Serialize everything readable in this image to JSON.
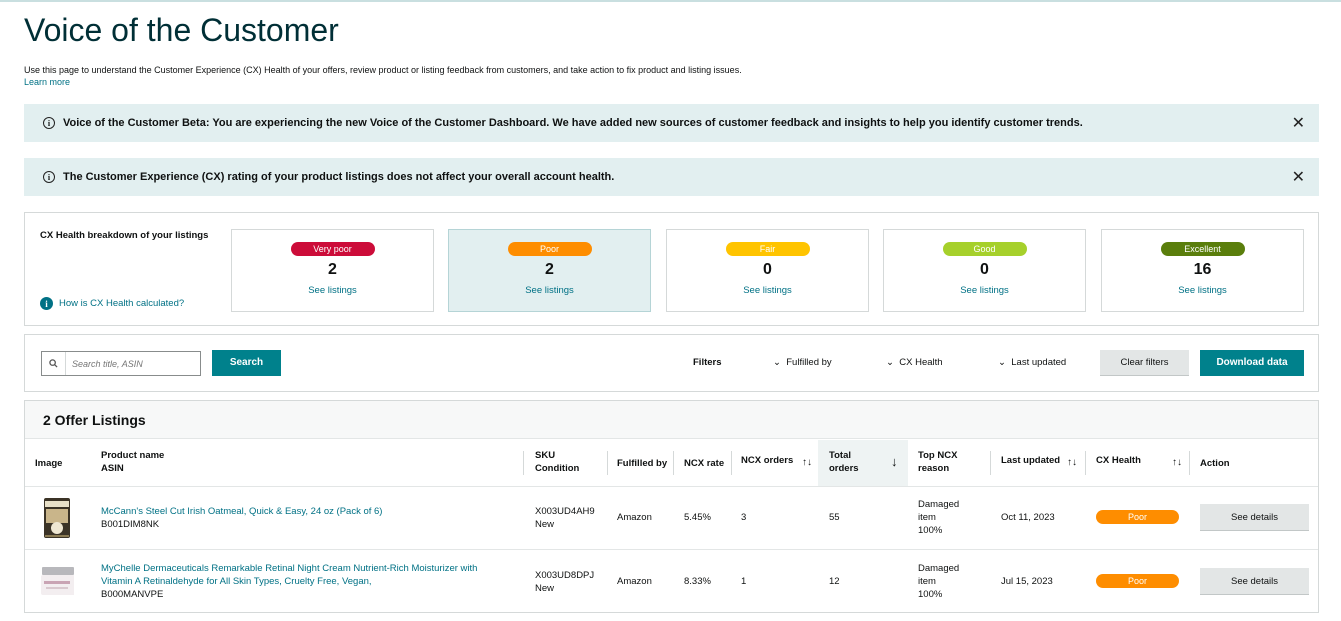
{
  "page": {
    "title": "Voice of the Customer",
    "description": "Use this page to understand the Customer Experience (CX) Health of your offers, review product or listing feedback from customers, and take action to fix product and listing issues.",
    "learn_more": "Learn more"
  },
  "banners": [
    {
      "icon": "info-icon",
      "text": "Voice of the Customer Beta: You are experiencing the new Voice of the Customer Dashboard. We have added new sources of customer feedback and insights to help you identify customer trends."
    },
    {
      "icon": "info-icon",
      "text": "The Customer Experience (CX) rating of your product listings does not affect your overall account health."
    }
  ],
  "cx_health": {
    "heading": "CX Health breakdown of your listings",
    "how_link": "How is CX Health calculated?",
    "cards": [
      {
        "label": "Very poor",
        "count": "2",
        "link": "See listings",
        "color": "#cc0c39"
      },
      {
        "label": "Poor",
        "count": "2",
        "link": "See listings",
        "color": "#fe8d00"
      },
      {
        "label": "Fair",
        "count": "0",
        "link": "See listings",
        "color": "#ffc400"
      },
      {
        "label": "Good",
        "count": "0",
        "link": "See listings",
        "color": "#a6d02b"
      },
      {
        "label": "Excellent",
        "count": "16",
        "link": "See listings",
        "color": "#5a7e0c"
      }
    ]
  },
  "filters": {
    "search_placeholder": "Search title, ASIN",
    "search_button": "Search",
    "filters_label": "Filters",
    "fulfilled_by": "Fulfilled by",
    "cx_health": "CX Health",
    "last_updated": "Last updated",
    "clear": "Clear filters",
    "download": "Download data"
  },
  "table": {
    "title": "2 Offer Listings",
    "headers": {
      "image": "Image",
      "product_name": "Product name",
      "asin": "ASIN",
      "sku": "SKU",
      "condition": "Condition",
      "fulfilled_by": "Fulfilled by",
      "ncx_rate": "NCX rate",
      "ncx_orders": "NCX orders",
      "total": "Total",
      "orders": "orders",
      "top_ncx": "Top NCX",
      "reason": "reason",
      "last_updated": "Last updated",
      "cx_health": "CX Health",
      "action": "Action"
    },
    "rows": [
      {
        "product": "McCann's Steel Cut Irish Oatmeal, Quick & Easy, 24 oz (Pack of 6)",
        "asin": "B001DIM8NK",
        "sku": "X003UD4AH9",
        "condition": "New",
        "fulfilled_by": "Amazon",
        "ncx_rate": "5.45%",
        "ncx_orders": "3",
        "total_orders": "55",
        "reason_1": "Damaged",
        "reason_2": "item",
        "reason_3": "100%",
        "last_updated": "Oct 11, 2023",
        "cx_health": "Poor",
        "action": "See details"
      },
      {
        "product_line1": "MyChelle Dermaceuticals Remarkable Retinal Night Cream Nutrient-Rich Moisturizer with",
        "product_line2": "Vitamin A Retinaldehyde for All Skin Types, Cruelty Free, Vegan,",
        "asin": "B000MANVPE",
        "sku": "X003UD8DPJ",
        "condition": "New",
        "fulfilled_by": "Amazon",
        "ncx_rate": "8.33%",
        "ncx_orders": "1",
        "total_orders": "12",
        "reason_1": "Damaged",
        "reason_2": "item",
        "reason_3": "100%",
        "last_updated": "Jul 15, 2023",
        "cx_health": "Poor",
        "action": "See details"
      }
    ]
  }
}
